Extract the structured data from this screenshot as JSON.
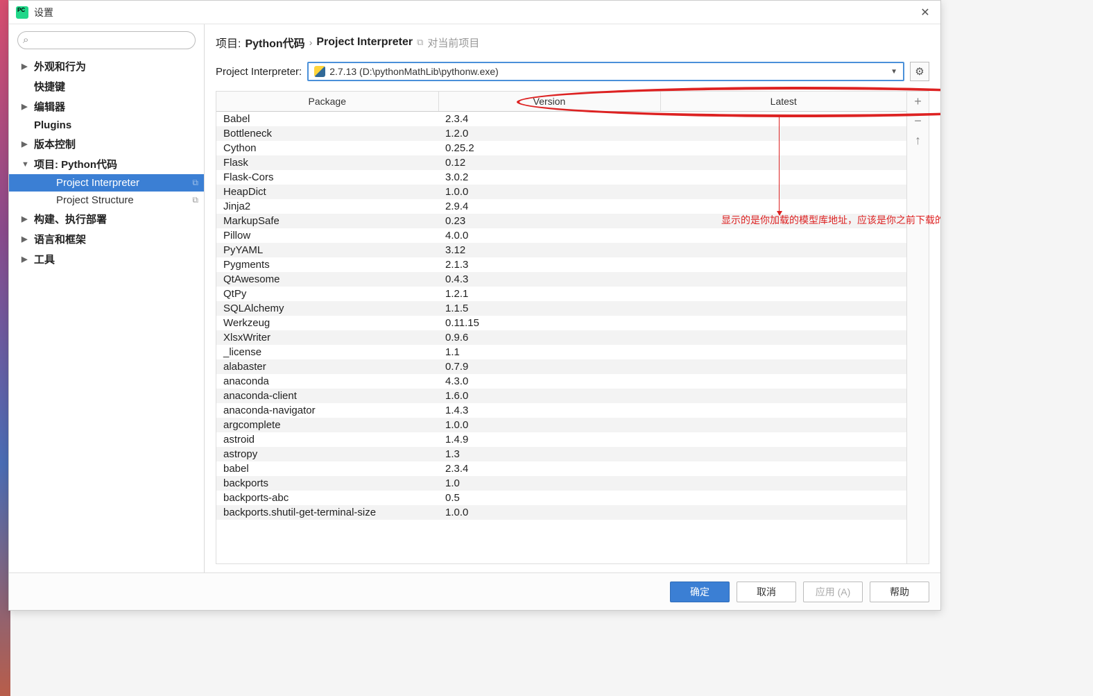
{
  "window": {
    "title": "设置",
    "close": "✕"
  },
  "sidebar": {
    "search_placeholder": "",
    "items": [
      {
        "label": "外观和行为",
        "arrow": "▶",
        "bold": true
      },
      {
        "label": "快捷键",
        "arrow": "",
        "bold": true
      },
      {
        "label": "编辑器",
        "arrow": "▶",
        "bold": true
      },
      {
        "label": "Plugins",
        "arrow": "",
        "bold": true
      },
      {
        "label": "版本控制",
        "arrow": "▶",
        "bold": true
      },
      {
        "label": "项目: Python代码",
        "arrow": "▼",
        "bold": true
      },
      {
        "label": "Project Interpreter",
        "arrow": "",
        "bold": false,
        "selected": true,
        "child": true,
        "copy": true
      },
      {
        "label": "Project Structure",
        "arrow": "",
        "bold": false,
        "child": true,
        "copy": true
      },
      {
        "label": "构建、执行部署",
        "arrow": "▶",
        "bold": true
      },
      {
        "label": "语言和框架",
        "arrow": "▶",
        "bold": true
      },
      {
        "label": "工具",
        "arrow": "▶",
        "bold": true
      }
    ]
  },
  "breadcrumb": {
    "part1": "项目:",
    "part2": "Python代码",
    "sep": "›",
    "part3": "Project Interpreter",
    "proj_label": "对当前项目"
  },
  "interpreter": {
    "label": "Project Interpreter:",
    "value": "2.7.13 (D:\\pythonMathLib\\pythonw.exe)"
  },
  "annotation": "显示的是你加载的模型库地址，应该是你之前下载的软件下的目录",
  "table": {
    "headers": {
      "pkg": "Package",
      "ver": "Version",
      "latest": "Latest"
    },
    "rows": [
      {
        "pkg": "Babel",
        "ver": "2.3.4"
      },
      {
        "pkg": "Bottleneck",
        "ver": "1.2.0"
      },
      {
        "pkg": "Cython",
        "ver": "0.25.2"
      },
      {
        "pkg": "Flask",
        "ver": "0.12"
      },
      {
        "pkg": "Flask-Cors",
        "ver": "3.0.2"
      },
      {
        "pkg": "HeapDict",
        "ver": "1.0.0"
      },
      {
        "pkg": "Jinja2",
        "ver": "2.9.4"
      },
      {
        "pkg": "MarkupSafe",
        "ver": "0.23"
      },
      {
        "pkg": "Pillow",
        "ver": "4.0.0"
      },
      {
        "pkg": "PyYAML",
        "ver": "3.12"
      },
      {
        "pkg": "Pygments",
        "ver": "2.1.3"
      },
      {
        "pkg": "QtAwesome",
        "ver": "0.4.3"
      },
      {
        "pkg": "QtPy",
        "ver": "1.2.1"
      },
      {
        "pkg": "SQLAlchemy",
        "ver": "1.1.5"
      },
      {
        "pkg": "Werkzeug",
        "ver": "0.11.15"
      },
      {
        "pkg": "XlsxWriter",
        "ver": "0.9.6"
      },
      {
        "pkg": "_license",
        "ver": "1.1"
      },
      {
        "pkg": "alabaster",
        "ver": "0.7.9"
      },
      {
        "pkg": "anaconda",
        "ver": "4.3.0"
      },
      {
        "pkg": "anaconda-client",
        "ver": "1.6.0"
      },
      {
        "pkg": "anaconda-navigator",
        "ver": "1.4.3"
      },
      {
        "pkg": "argcomplete",
        "ver": "1.0.0"
      },
      {
        "pkg": "astroid",
        "ver": "1.4.9"
      },
      {
        "pkg": "astropy",
        "ver": "1.3"
      },
      {
        "pkg": "babel",
        "ver": "2.3.4"
      },
      {
        "pkg": "backports",
        "ver": "1.0"
      },
      {
        "pkg": "backports-abc",
        "ver": "0.5"
      },
      {
        "pkg": "backports.shutil-get-terminal-size",
        "ver": "1.0.0"
      }
    ]
  },
  "side_buttons": {
    "add": "+",
    "remove": "−",
    "up": "↑"
  },
  "footer": {
    "ok": "确定",
    "cancel": "取消",
    "apply": "应用 (A)",
    "help": "帮助"
  }
}
